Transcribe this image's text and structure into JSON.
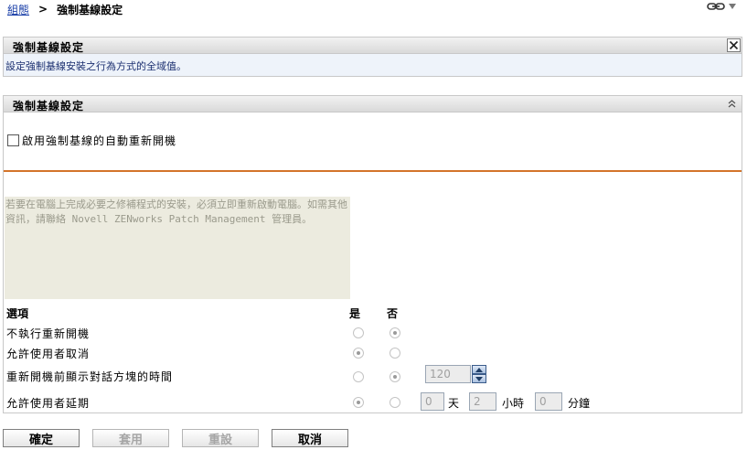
{
  "breadcrumb": {
    "parent_label": "組態",
    "separator": ">",
    "current_label": "強制基線設定"
  },
  "top_icons": [
    "link-icon",
    "dropdown-arrow-icon"
  ],
  "info_panel": {
    "title": "強制基線設定",
    "description": "設定強制基線安裝之行為方式的全域值。",
    "close_icon": "close-icon"
  },
  "settings_panel": {
    "title": "強制基線設定",
    "collapse_icon": "double-chevron-up-icon",
    "enable_auto_reboot": {
      "label": "啟用強制基線的自動重新開機",
      "checked": false
    },
    "message": "若要在電腦上完成必要之修補程式的安裝，必須立即重新啟動電腦。如需其他資訊，請聯絡 Novell ZENworks Patch Management 管理員。",
    "options": {
      "header_option": "選項",
      "header_yes": "是",
      "header_no": "否",
      "rows": [
        {
          "label": "不執行重新開機",
          "selected": "no"
        },
        {
          "label": "允許使用者取消",
          "selected": "yes"
        },
        {
          "label": "重新開機前顯示對話方塊的時間",
          "selected": "no",
          "value": "120"
        },
        {
          "label": "允許使用者延期",
          "selected": "yes",
          "days": "0",
          "days_unit": "天",
          "hours": "2",
          "hours_unit": "小時",
          "minutes": "0",
          "minutes_unit": "分鐘"
        }
      ]
    }
  },
  "actions": {
    "ok_label": "確定",
    "apply_label": "套用",
    "reset_label": "重設",
    "cancel_label": "取消"
  },
  "colors": {
    "link": "#1a3fa8",
    "accent_rule": "#d4742a",
    "info_bg": "#eef3fa",
    "message_bg": "#ecebdf"
  }
}
